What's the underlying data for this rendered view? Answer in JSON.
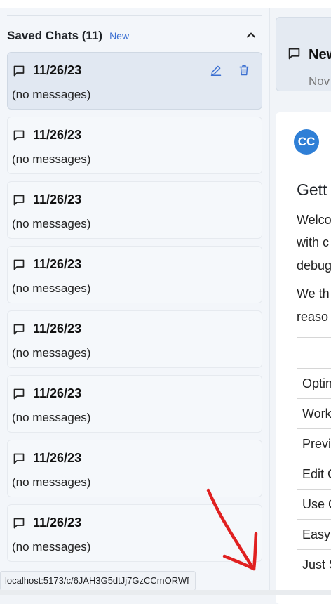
{
  "sidebar": {
    "header": {
      "title": "Saved Chats (11)",
      "badge": "New"
    },
    "chats": [
      {
        "date": "11/26/23",
        "preview": "(no messages)",
        "active": true
      },
      {
        "date": "11/26/23",
        "preview": "(no messages)",
        "active": false
      },
      {
        "date": "11/26/23",
        "preview": "(no messages)",
        "active": false
      },
      {
        "date": "11/26/23",
        "preview": "(no messages)",
        "active": false
      },
      {
        "date": "11/26/23",
        "preview": "(no messages)",
        "active": false
      },
      {
        "date": "11/26/23",
        "preview": "(no messages)",
        "active": false
      },
      {
        "date": "11/26/23",
        "preview": "(no messages)",
        "active": false
      },
      {
        "date": "11/26/23",
        "preview": "(no messages)",
        "active": false
      }
    ]
  },
  "main": {
    "new_chat_card": {
      "title": "New",
      "date": "Nov"
    },
    "avatar": "CC",
    "heading": "Gett",
    "paragraphs": [
      "Welco",
      "with c",
      "debug",
      "We th",
      "reaso"
    ],
    "table_rows": [
      "",
      "Optin",
      "Work",
      "Previ",
      "Edit C",
      "Use C",
      "Easy",
      "Just S"
    ]
  },
  "status_bar": {
    "url": "localhost:5173/c/6JAH3G5dtJj7GzCCmORWf"
  },
  "colors": {
    "accent": "#3b6fd1",
    "avatar": "#2f7fd6",
    "annotation": "#e02020"
  },
  "icons": {
    "chat": "message-square-icon",
    "edit": "pencil-icon",
    "delete": "trash-icon",
    "collapse": "chevron-up-icon"
  }
}
